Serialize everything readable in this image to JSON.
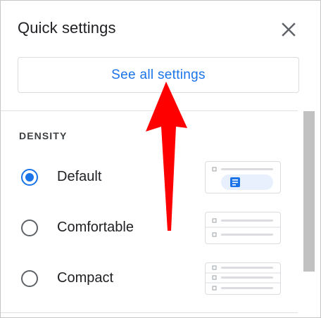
{
  "panel": {
    "title": "Quick settings",
    "close_icon": "close-icon",
    "see_all_label": "See all settings"
  },
  "density": {
    "section_label": "DENSITY",
    "options": [
      {
        "label": "Default",
        "selected": true
      },
      {
        "label": "Comfortable",
        "selected": false
      },
      {
        "label": "Compact",
        "selected": false
      }
    ]
  },
  "colors": {
    "accent": "#1a73e8",
    "annotation_arrow": "#ff0000"
  }
}
